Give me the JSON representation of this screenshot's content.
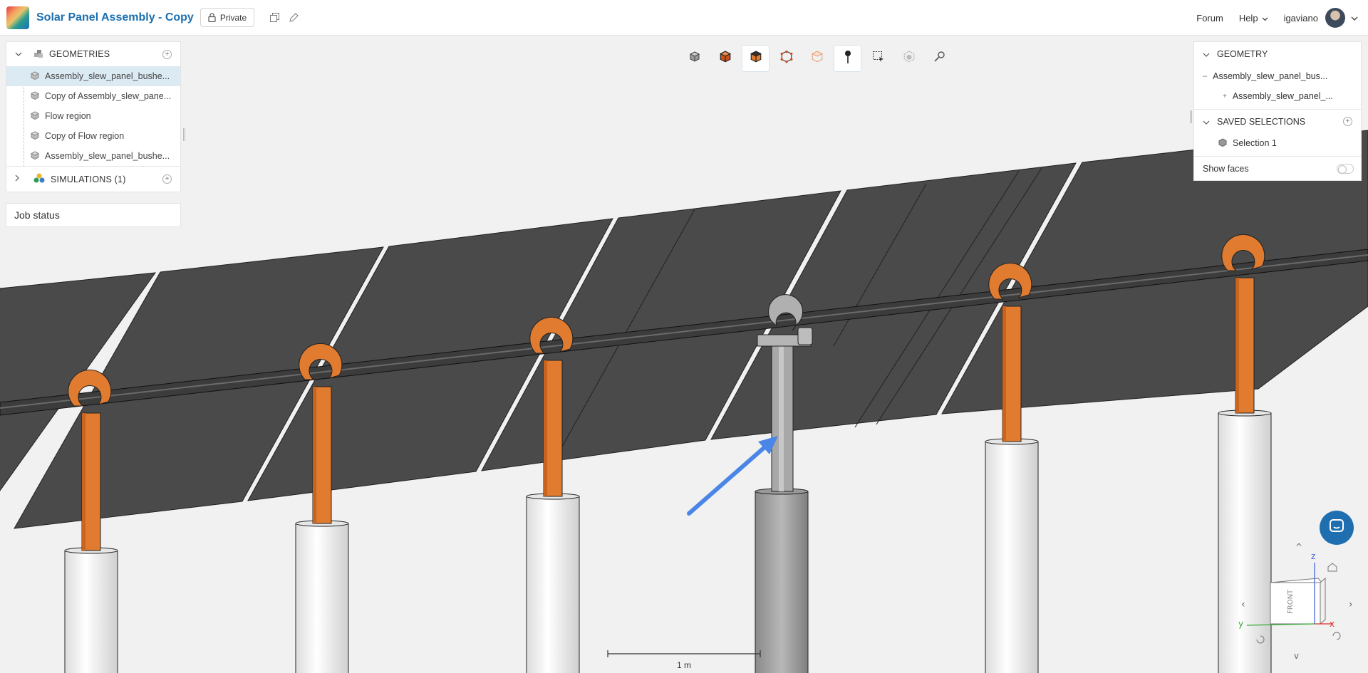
{
  "header": {
    "project_title": "Solar Panel Assembly - Copy",
    "privacy_label": "Private",
    "forum_label": "Forum",
    "help_label": "Help",
    "username": "igaviano"
  },
  "left_panel": {
    "geometries_label": "GEOMETRIES",
    "geometries": [
      "Assembly_slew_panel_bushe...",
      "Copy of Assembly_slew_pane...",
      "Flow region",
      "Copy of Flow region",
      "Assembly_slew_panel_bushe..."
    ],
    "simulations_label": "SIMULATIONS (1)",
    "job_status_label": "Job status"
  },
  "right_panel": {
    "geometry_label": "GEOMETRY",
    "geometry_root": "Assembly_slew_panel_bus...",
    "geometry_child": "Assembly_slew_panel_...",
    "saved_selections_label": "SAVED SELECTIONS",
    "selection_item": "Selection 1",
    "show_faces_label": "Show faces",
    "show_faces_enabled": false
  },
  "viewport": {
    "scale_label": "1 m",
    "view_cube_face": "FRONT",
    "axis_z": "z",
    "axis_y": "y",
    "axis_x": "x"
  },
  "toolbar": {
    "tools": [
      "view-mode-icon",
      "solid-cube-icon",
      "selected-cube-icon",
      "vertex-cube-icon",
      "transparent-cube-icon",
      "point-picker-icon",
      "box-select-icon",
      "hide-icon",
      "measure-icon"
    ]
  },
  "colors": {
    "accent": "#1b6fb0",
    "bracket_orange": "#e07b30",
    "panel_dark": "#4a4a4a",
    "arrow_blue": "#4a86e8"
  }
}
